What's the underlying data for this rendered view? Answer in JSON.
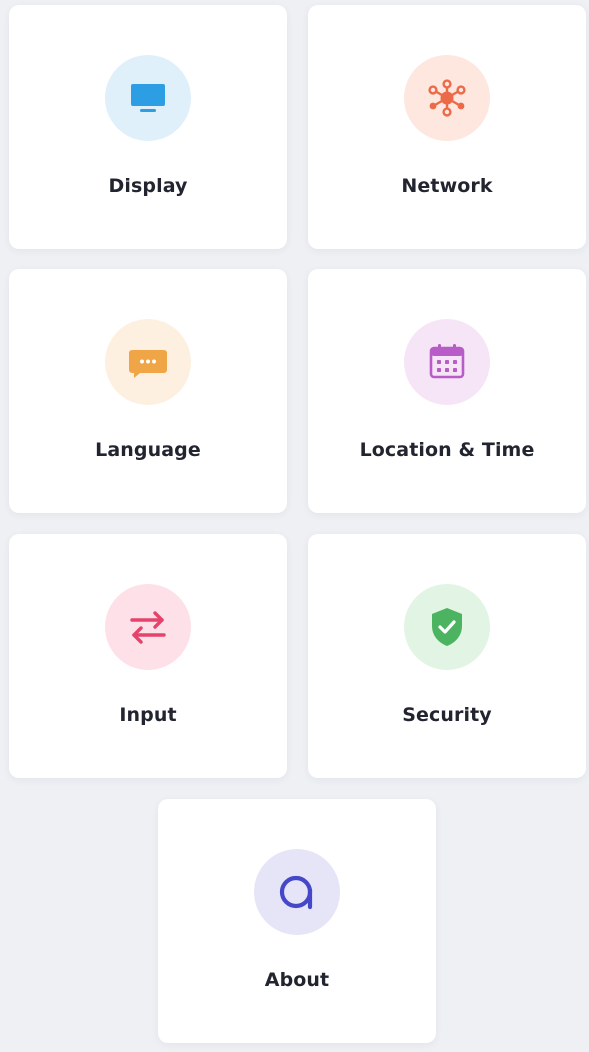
{
  "settings_tiles": {
    "display": {
      "label": "Display",
      "icon": "monitor-icon",
      "icon_color": "#2e9ee4",
      "bg_color": "#e0f0fb"
    },
    "network": {
      "label": "Network",
      "icon": "network-icon",
      "icon_color": "#ec6a47",
      "bg_color": "#fde7de"
    },
    "language": {
      "label": "Language",
      "icon": "chat-bubble-icon",
      "icon_color": "#f0a546",
      "bg_color": "#fdf0e0"
    },
    "location": {
      "label": "Location & Time",
      "icon": "calendar-icon",
      "icon_color": "#b85cc7",
      "bg_color": "#f6e5f6"
    },
    "input": {
      "label": "Input",
      "icon": "swap-arrows-icon",
      "icon_color": "#e4436b",
      "bg_color": "#fde0e8"
    },
    "security": {
      "label": "Security",
      "icon": "shield-check-icon",
      "icon_color": "#4cb360",
      "bg_color": "#e2f4e3"
    },
    "about": {
      "label": "About",
      "icon": "about-logo-icon",
      "icon_color": "#4548c8",
      "bg_color": "#e6e5f8"
    }
  }
}
